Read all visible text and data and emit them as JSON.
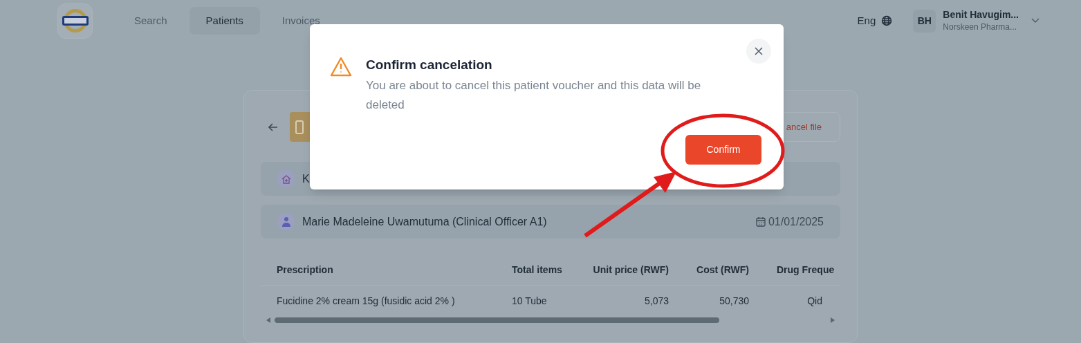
{
  "nav": {
    "tabs": [
      {
        "label": "Search",
        "selected": false
      },
      {
        "label": "Patients",
        "selected": true
      },
      {
        "label": "Invoices",
        "selected": false
      }
    ]
  },
  "header": {
    "language": "Eng",
    "user": {
      "initials": "BH",
      "name": "Benit Havugim...",
      "organization": "Norskeen Pharma..."
    }
  },
  "card": {
    "cancel_button": "ancel file",
    "info_rows": [
      {
        "kind": "facility",
        "text": "K"
      },
      {
        "kind": "doctor",
        "text": "Marie Madeleine Uwamutuma (Clinical Officer A1)",
        "date": "01/01/2025"
      }
    ],
    "table": {
      "columns": [
        {
          "label": "Prescription"
        },
        {
          "label": "Total items"
        },
        {
          "label": "Unit price (RWF)"
        },
        {
          "label": "Cost (RWF)"
        },
        {
          "label": "Drug Freque"
        }
      ],
      "rows": [
        [
          "Fucidine 2% cream 15g (fusidic acid 2% )",
          "10 Tube",
          "5,073",
          "50,730",
          "Qid"
        ]
      ]
    }
  },
  "modal": {
    "title": "Confirm cancelation",
    "message": "You are about to cancel this patient voucher and this data will be deleted",
    "confirm_button": "Confirm"
  }
}
